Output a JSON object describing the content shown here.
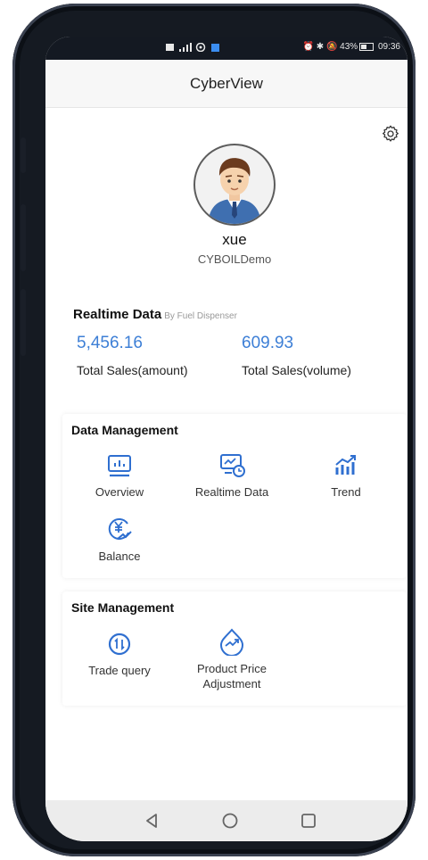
{
  "status_bar": {
    "left_icons": [
      "notification-icon",
      "signal-icon",
      "wifi-icon",
      "app-icon"
    ],
    "battery": "43%",
    "time": "09:36"
  },
  "app": {
    "title": "CyberView"
  },
  "profile": {
    "username": "xue",
    "company": "CYBOILDemo"
  },
  "realtime": {
    "title": "Realtime Data",
    "subtitle": "By Fuel Dispenser",
    "amount_value": "5,456.16",
    "amount_label": "Total Sales(amount)",
    "volume_value": "609.93",
    "volume_label": "Total Sales(volume)"
  },
  "data_management": {
    "title": "Data Management",
    "items": [
      {
        "label": "Overview",
        "icon": "overview-icon"
      },
      {
        "label": "Realtime Data",
        "icon": "realtime-data-icon"
      },
      {
        "label": "Trend",
        "icon": "trend-icon"
      },
      {
        "label": "Balance",
        "icon": "balance-icon"
      }
    ]
  },
  "site_management": {
    "title": "Site Management",
    "items": [
      {
        "label": "Trade query",
        "icon": "trade-query-icon"
      },
      {
        "label": "Product Price Adjustment",
        "icon": "price-adjustment-icon"
      }
    ]
  },
  "colors": {
    "accent": "#3d7fd6",
    "icon_blue": "#2f6fd0"
  }
}
